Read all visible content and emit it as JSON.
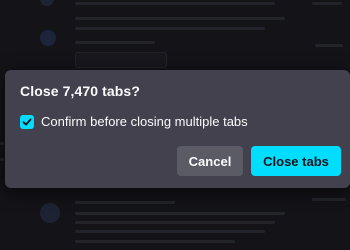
{
  "dialog": {
    "title": "Close 7,470 tabs?",
    "checkbox_label": "Confirm before closing multiple tabs",
    "checkbox_checked": true,
    "cancel_label": "Cancel",
    "confirm_label": "Close tabs"
  },
  "colors": {
    "accent": "#00ddff",
    "dialog_bg": "#42414d",
    "secondary_button": "#5b5b66"
  }
}
